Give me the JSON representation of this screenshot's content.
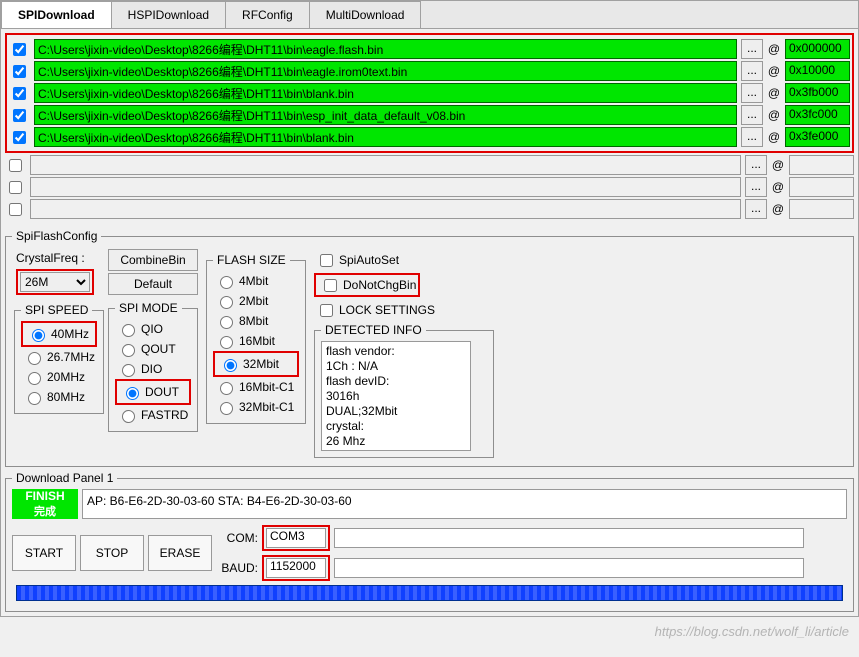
{
  "tabs": [
    "SPIDownload",
    "HSPIDownload",
    "RFConfig",
    "MultiDownload"
  ],
  "activeTab": 0,
  "rows": [
    {
      "checked": true,
      "path": "C:\\Users\\jixin-video\\Desktop\\8266编程\\DHT11\\bin\\eagle.flash.bin",
      "addr": "0x000000",
      "green": true
    },
    {
      "checked": true,
      "path": "C:\\Users\\jixin-video\\Desktop\\8266编程\\DHT11\\bin\\eagle.irom0text.bin",
      "addr": "0x10000",
      "green": true
    },
    {
      "checked": true,
      "path": "C:\\Users\\jixin-video\\Desktop\\8266编程\\DHT11\\bin\\blank.bin",
      "addr": "0x3fb000",
      "green": true
    },
    {
      "checked": true,
      "path": "C:\\Users\\jixin-video\\Desktop\\8266编程\\DHT11\\bin\\esp_init_data_default_v08.bin",
      "addr": "0x3fc000",
      "green": true
    },
    {
      "checked": true,
      "path": "C:\\Users\\jixin-video\\Desktop\\8266编程\\DHT11\\bin\\blank.bin",
      "addr": "0x3fe000",
      "green": true
    },
    {
      "checked": false,
      "path": "",
      "addr": "",
      "green": false
    },
    {
      "checked": false,
      "path": "",
      "addr": "",
      "green": false
    },
    {
      "checked": false,
      "path": "",
      "addr": "",
      "green": false
    }
  ],
  "browse": "...",
  "at": "@",
  "spiFlashConfigLabel": "SpiFlashConfig",
  "crystalLabel": "CrystalFreq :",
  "crystalValue": "26M",
  "combineBin": "CombineBin",
  "defaultBtn": "Default",
  "spiSpeed": {
    "label": "SPI SPEED",
    "options": [
      "40MHz",
      "26.7MHz",
      "20MHz",
      "80MHz"
    ],
    "selected": "40MHz"
  },
  "spiMode": {
    "label": "SPI MODE",
    "options": [
      "QIO",
      "QOUT",
      "DIO",
      "DOUT",
      "FASTRD"
    ],
    "selected": "DOUT"
  },
  "flashSize": {
    "label": "FLASH SIZE",
    "options": [
      "4Mbit",
      "2Mbit",
      "8Mbit",
      "16Mbit",
      "32Mbit",
      "16Mbit-C1",
      "32Mbit-C1"
    ],
    "selected": "32Mbit"
  },
  "spiAutoSet": "SpiAutoSet",
  "doNotChgBin": "DoNotChgBin",
  "lockSettings": "LOCK SETTINGS",
  "detectedLabel": "DETECTED INFO",
  "detected": "flash vendor:\n1Ch : N/A\nflash devID:\n3016h\nDUAL;32Mbit\ncrystal:\n26 Mhz",
  "panel1Label": "Download Panel 1",
  "finish": {
    "en": "FINISH",
    "cn": "完成"
  },
  "sta": "AP:  B6-E6-2D-30-03-60  STA:  B4-E6-2D-30-03-60",
  "start": "START",
  "stop": "STOP",
  "erase": "ERASE",
  "comLabel": "COM:",
  "comValue": "COM3",
  "baudLabel": "BAUD:",
  "baudValue": "1152000",
  "watermark": "https://blog.csdn.net/wolf_li/article"
}
